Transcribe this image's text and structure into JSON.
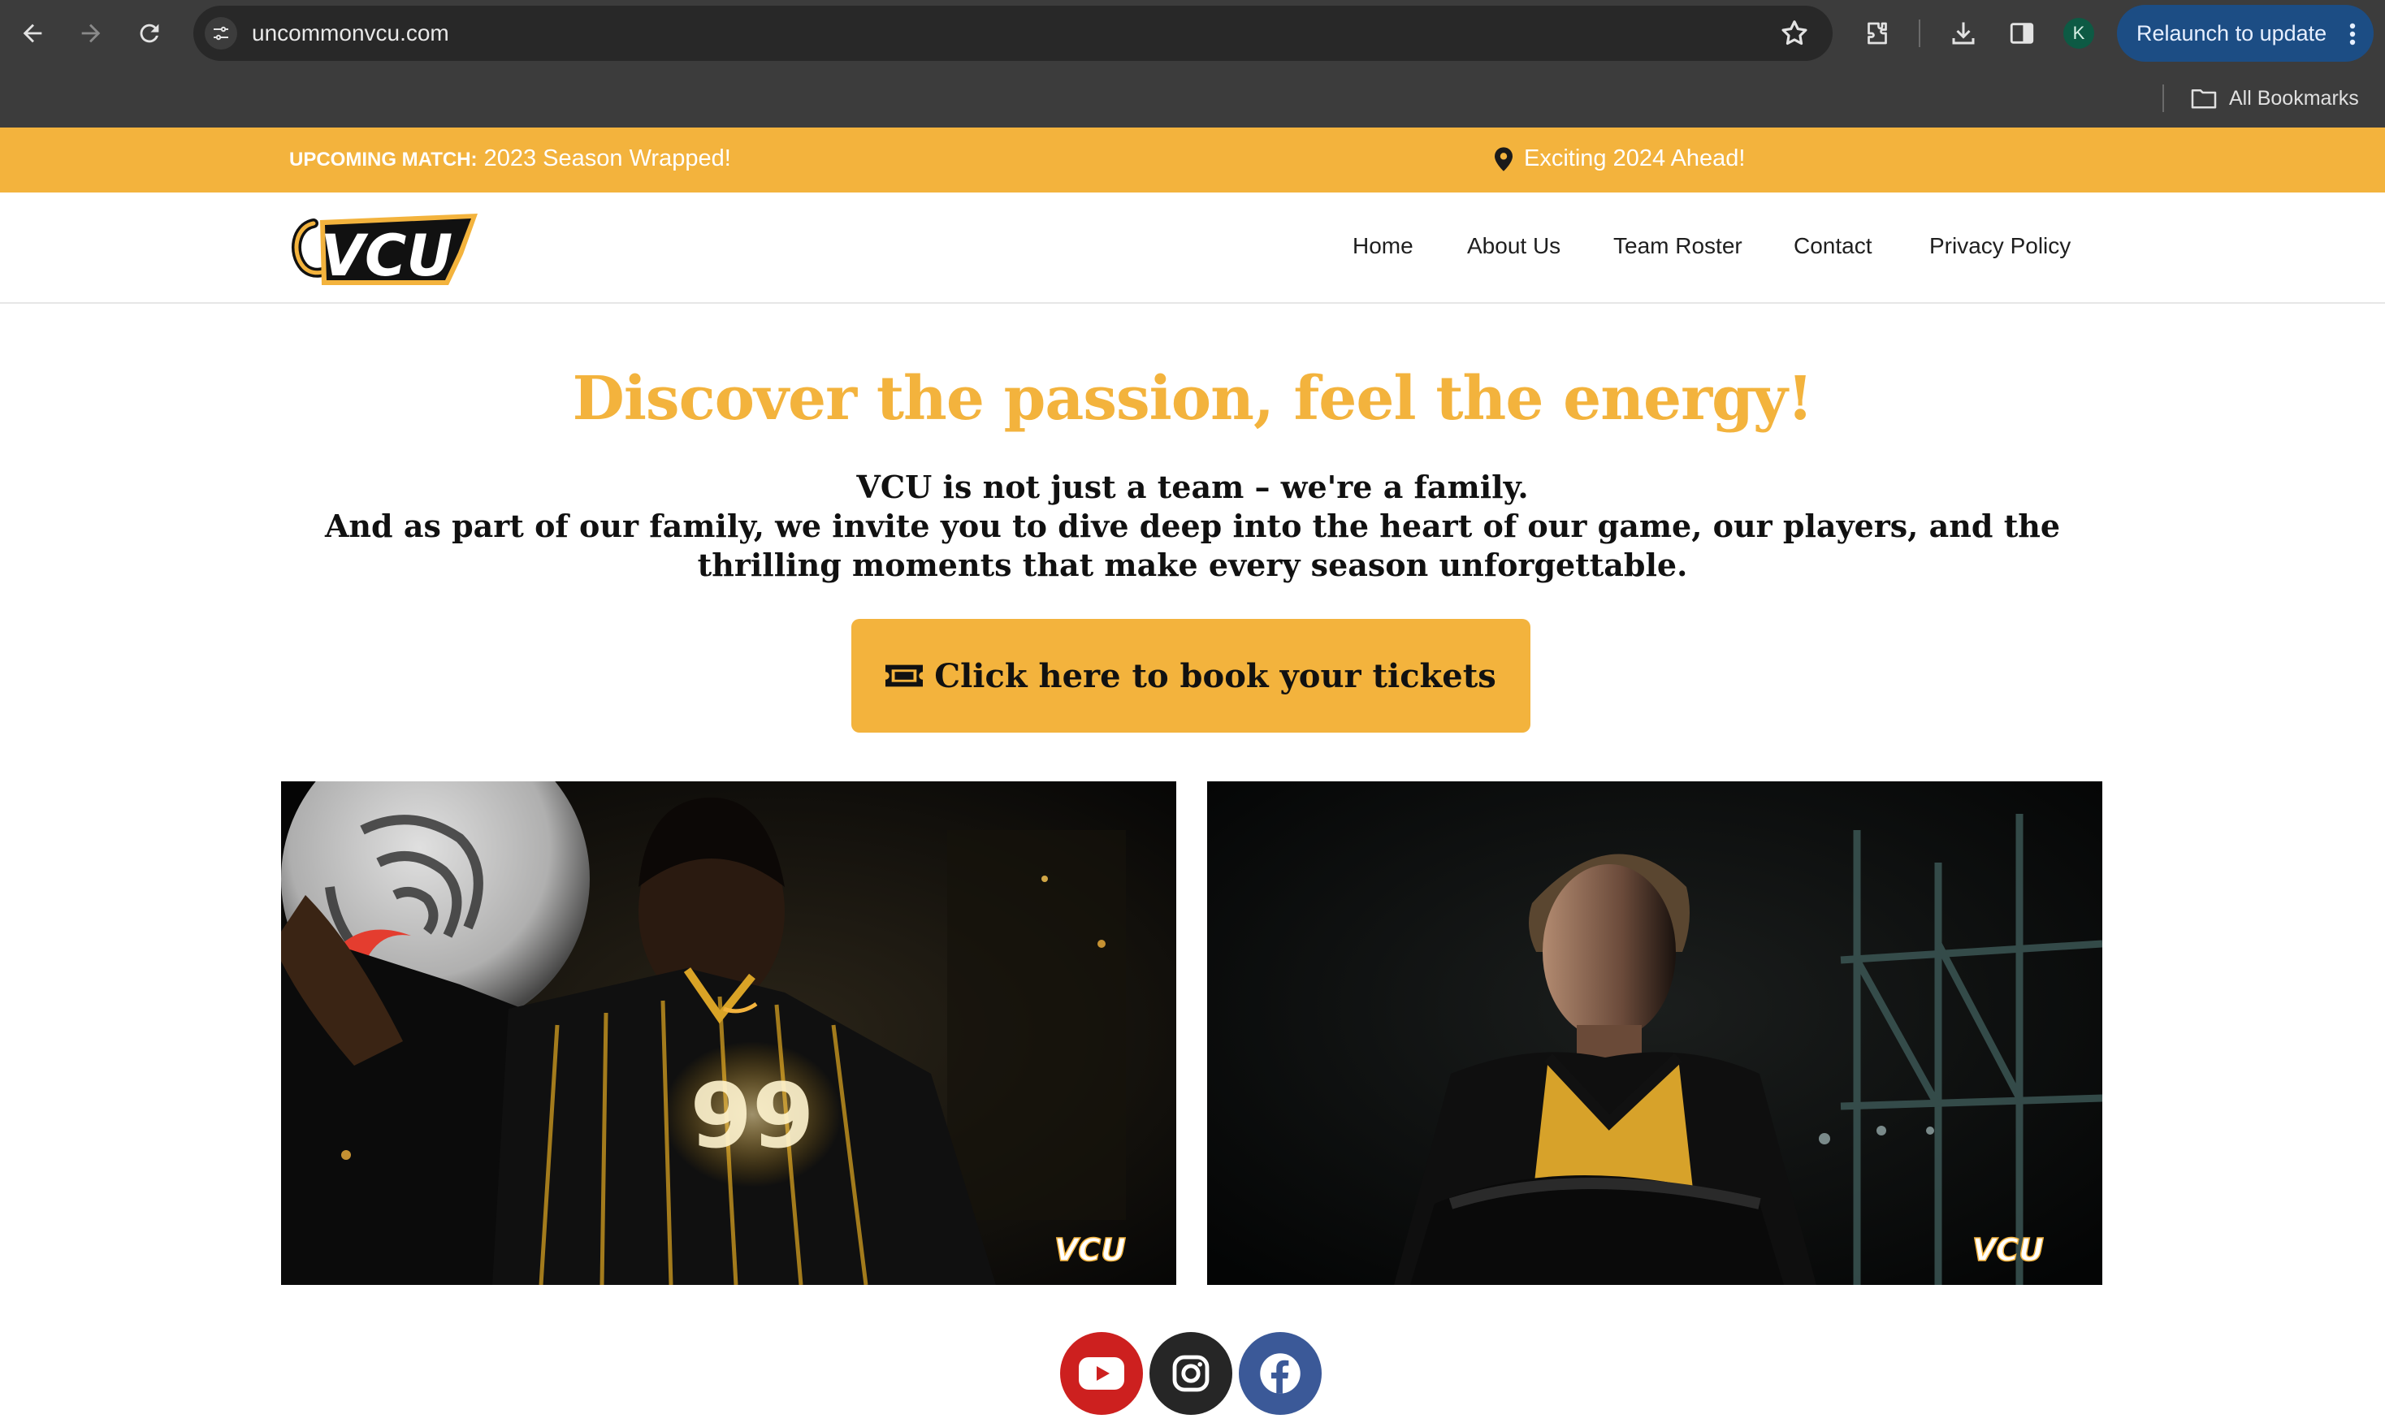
{
  "browser": {
    "url": "uncommonvcu.com",
    "profile_initial": "K",
    "relaunch_label": "Relaunch to update",
    "bookmarks_label": "All Bookmarks",
    "icons": [
      "back-icon",
      "forward-icon",
      "reload-icon",
      "site-settings-icon",
      "bookmark-star-icon",
      "extensions-icon",
      "download-icon",
      "side-panel-icon",
      "more-vert-icon",
      "folder-icon"
    ]
  },
  "topbar": {
    "match_label": "UPCOMING MATCH:",
    "match_text": " 2023 Season Wrapped!",
    "promo_text": "Exciting 2024 Ahead!",
    "promo_icon": "map-marker-icon",
    "color": "#f3b33d"
  },
  "header": {
    "logo_text": "VCU",
    "nav": [
      {
        "label": "Home"
      },
      {
        "label": "About Us"
      },
      {
        "label": "Team Roster"
      },
      {
        "label": "Contact"
      },
      {
        "label": "Privacy Policy"
      }
    ]
  },
  "hero": {
    "title": "Discover the passion, feel the energy!",
    "line1": "VCU is not just a team – we're a family.",
    "line2": "And as part of our family, we invite you to dive deep into the heart of our game, our players, and the thrilling moments that make every season unforgettable.",
    "cta_label": "Click here to book your tickets",
    "cta_icon": "ticket-icon",
    "accent": "#f3b33d"
  },
  "photos": [
    {
      "name": "male-player-photo",
      "jersey_number": "99",
      "watermark": "VCU"
    },
    {
      "name": "female-player-photo",
      "watermark": "VCU"
    }
  ],
  "social": [
    {
      "name": "youtube",
      "icon": "youtube-icon",
      "color": "#cd201f"
    },
    {
      "name": "instagram",
      "icon": "instagram-icon",
      "color": "#262626"
    },
    {
      "name": "facebook",
      "icon": "facebook-icon",
      "color": "#3b5998"
    }
  ]
}
